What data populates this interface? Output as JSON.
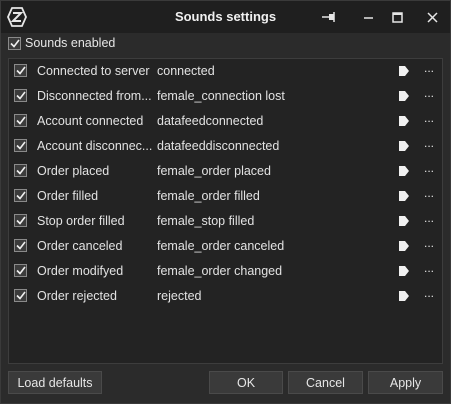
{
  "window": {
    "title": "Sounds settings"
  },
  "sounds_enabled": {
    "label": "Sounds enabled",
    "checked": true
  },
  "events": [
    {
      "checked": true,
      "name": "Connected to server",
      "sound": "connected"
    },
    {
      "checked": true,
      "name": "Disconnected from...",
      "sound": "female_connection lost"
    },
    {
      "checked": true,
      "name": "Account connected",
      "sound": "datafeedconnected"
    },
    {
      "checked": true,
      "name": "Account disconnec...",
      "sound": "datafeeddisconnected"
    },
    {
      "checked": true,
      "name": "Order placed",
      "sound": "female_order placed"
    },
    {
      "checked": true,
      "name": "Order filled",
      "sound": "female_order filled"
    },
    {
      "checked": true,
      "name": "Stop order filled",
      "sound": "female_stop filled"
    },
    {
      "checked": true,
      "name": "Order canceled",
      "sound": "female_order canceled"
    },
    {
      "checked": true,
      "name": "Order modifyed",
      "sound": "female_order changed"
    },
    {
      "checked": true,
      "name": "Order rejected",
      "sound": "rejected"
    }
  ],
  "more_label": "...",
  "buttons": {
    "load_defaults": "Load defaults",
    "ok": "OK",
    "cancel": "Cancel",
    "apply": "Apply"
  }
}
